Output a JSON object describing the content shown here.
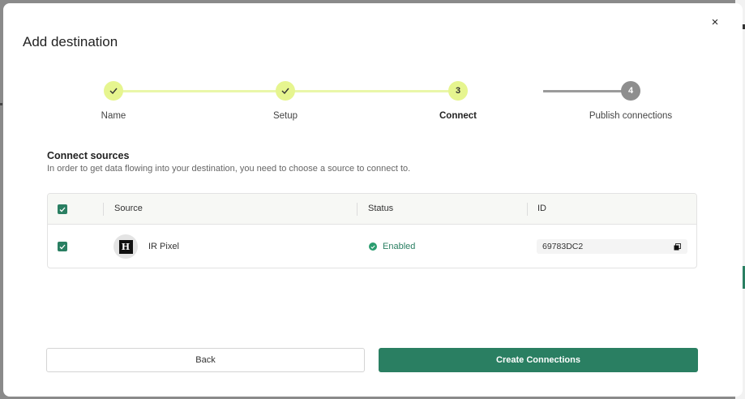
{
  "modal": {
    "title": "Add destination",
    "close_label": "×"
  },
  "stepper": {
    "steps": [
      {
        "label": "Name",
        "number": "1",
        "state": "done"
      },
      {
        "label": "Setup",
        "number": "2",
        "state": "done"
      },
      {
        "label": "Connect",
        "number": "3",
        "state": "active"
      },
      {
        "label": "Publish connections",
        "number": "4",
        "state": "todo"
      }
    ]
  },
  "section": {
    "title": "Connect sources",
    "description": "In order to get data flowing into your destination, you need to choose a source to connect to."
  },
  "table": {
    "columns": [
      "Source",
      "Status",
      "ID"
    ],
    "rows": [
      {
        "source_initial": "H",
        "source": "IR Pixel",
        "status": "Enabled",
        "id": "69783DC2",
        "checked": true
      }
    ]
  },
  "footer": {
    "back_label": "Back",
    "create_label": "Create Connections"
  },
  "colors": {
    "accent": "#2a7f62",
    "step_done": "#e6f58f",
    "step_todo": "#8e8e8e"
  }
}
